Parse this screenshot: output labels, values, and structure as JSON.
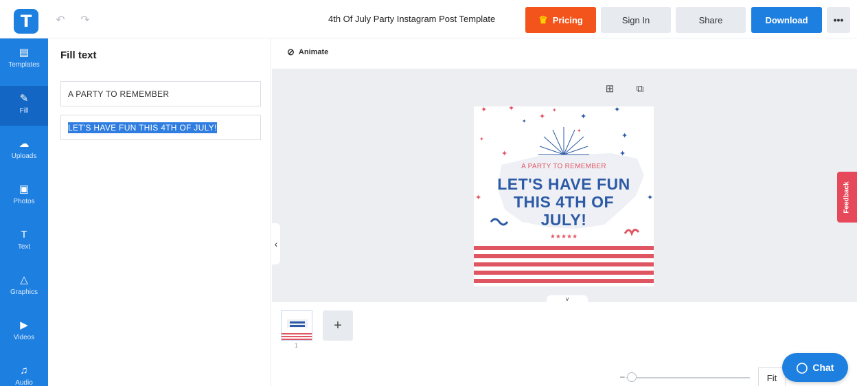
{
  "colors": {
    "brand_blue": "#1d7fe0",
    "pricing_orange": "#f2541b",
    "headline_blue": "#2c5aa5",
    "accent_red": "#e05562",
    "feedback_red": "#e64a5a"
  },
  "header": {
    "logo_letter": "T",
    "undo_icon": "↶",
    "redo_icon": "↷",
    "document_title": "4th Of July Party Instagram Post Template",
    "pricing_label": "Pricing",
    "crown_icon": "♛",
    "signin_label": "Sign In",
    "share_label": "Share",
    "download_label": "Download",
    "more_label": "•••"
  },
  "rail": {
    "items": [
      {
        "label": "Templates",
        "icon": "▤"
      },
      {
        "label": "Fill",
        "icon": "✎"
      },
      {
        "label": "Uploads",
        "icon": "☁"
      },
      {
        "label": "Photos",
        "icon": "▣"
      },
      {
        "label": "Text",
        "icon": "T"
      },
      {
        "label": "Graphics",
        "icon": "△"
      },
      {
        "label": "Videos",
        "icon": "▶"
      },
      {
        "label": "Audio",
        "icon": "♫"
      }
    ]
  },
  "panel": {
    "title": "Fill text",
    "fields": [
      {
        "value": "A PARTY TO REMEMBER"
      },
      {
        "value": "LET'S HAVE FUN THIS 4TH OF JULY!"
      }
    ]
  },
  "toolbar": {
    "animate_label": "Animate",
    "animate_icon": "⊘"
  },
  "canvas": {
    "add_icon": "⊞",
    "copy_icon": "⧉",
    "collapse_icon": "‹",
    "expand_icon": "˅",
    "design": {
      "subtitle": "A PARTY TO REMEMBER",
      "headline": "LET'S HAVE FUN THIS 4TH OF JULY!",
      "stars": "★★★★★"
    }
  },
  "feedback_label": "Feedback",
  "pages": {
    "thumb_number": "1",
    "add_icon": "+"
  },
  "zoom": {
    "minus_icon": "–",
    "fit_label": "Fit"
  },
  "chat": {
    "label": "Chat",
    "icon": "◯"
  }
}
